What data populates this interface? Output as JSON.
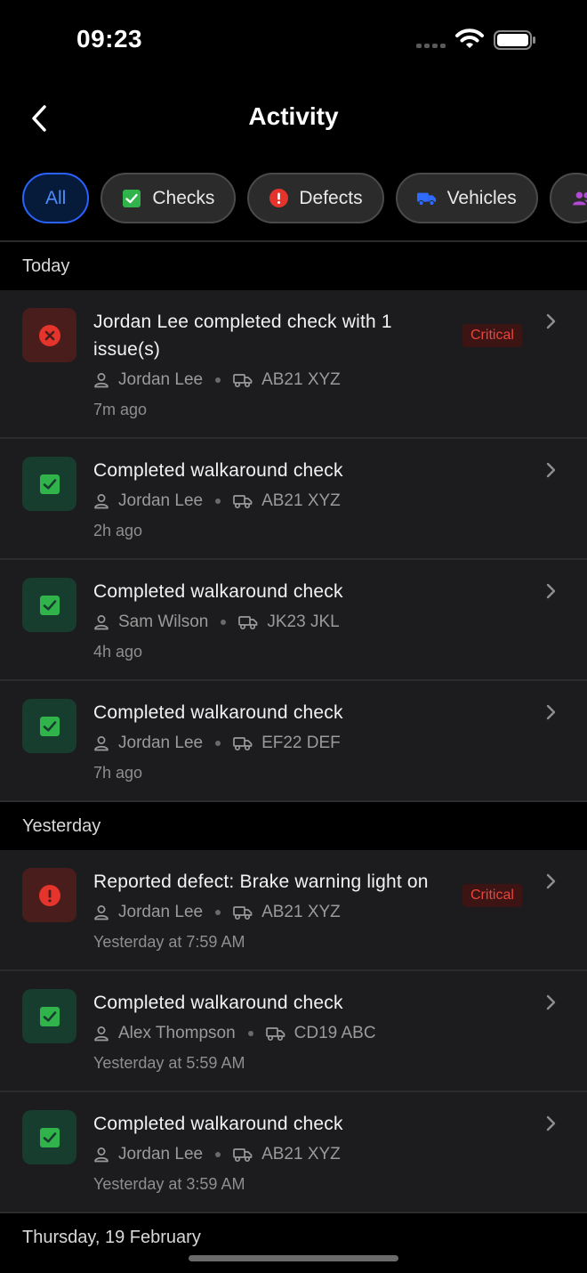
{
  "status_bar": {
    "time": "09:23"
  },
  "nav": {
    "title": "Activity",
    "back_icon": "chevron-left-icon"
  },
  "filters": [
    {
      "label": "All",
      "active": true
    },
    {
      "label": "Checks",
      "icon": "check-square-icon",
      "icon_color": "#2fb34a"
    },
    {
      "label": "Defects",
      "icon": "alert-circle-icon",
      "icon_color": "#e5342b"
    },
    {
      "label": "Vehicles",
      "icon": "truck-icon",
      "icon_color": "#2f6bff"
    },
    {
      "label": "",
      "icon": "people-icon",
      "icon_color": "#b34ad6"
    }
  ],
  "sections": [
    {
      "title": "Today",
      "items": [
        {
          "type": "issue",
          "icon": "x-circle-icon",
          "title": "Jordan Lee completed check with 1 issue(s)",
          "badge": "Critical",
          "driver": "Jordan Lee",
          "vehicle": "AB21 XYZ",
          "time": "7m ago"
        },
        {
          "type": "check",
          "icon": "check-square-icon",
          "title": "Completed walkaround check",
          "driver": "Jordan Lee",
          "vehicle": "AB21 XYZ",
          "time": "2h ago"
        },
        {
          "type": "check",
          "icon": "check-square-icon",
          "title": "Completed walkaround check",
          "driver": "Sam Wilson",
          "vehicle": "JK23 JKL",
          "time": "4h ago"
        },
        {
          "type": "check",
          "icon": "check-square-icon",
          "title": "Completed walkaround check",
          "driver": "Jordan Lee",
          "vehicle": "EF22 DEF",
          "time": "7h ago"
        }
      ]
    },
    {
      "title": "Yesterday",
      "items": [
        {
          "type": "issue",
          "icon": "alert-circle-icon",
          "title": "Reported defect: Brake warning light on",
          "badge": "Critical",
          "driver": "Jordan Lee",
          "vehicle": "AB21 XYZ",
          "time": "Yesterday at 7:59 AM"
        },
        {
          "type": "check",
          "icon": "check-square-icon",
          "title": "Completed walkaround check",
          "driver": "Alex Thompson",
          "vehicle": "CD19 ABC",
          "time": "Yesterday at 5:59 AM"
        },
        {
          "type": "check",
          "icon": "check-square-icon",
          "title": "Completed walkaround check",
          "driver": "Jordan Lee",
          "vehicle": "AB21 XYZ",
          "time": "Yesterday at 3:59 AM"
        }
      ]
    },
    {
      "title": "Thursday, 19 February",
      "items": []
    }
  ],
  "colors": {
    "background": "#000000",
    "card": "#1c1c1e",
    "accent": "#2a62ff",
    "success": "#2fb34a",
    "critical": "#e5342b"
  }
}
